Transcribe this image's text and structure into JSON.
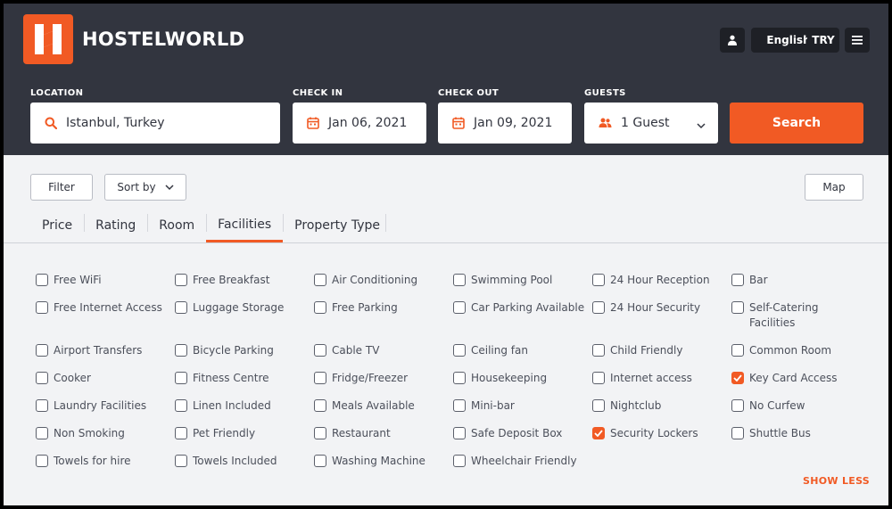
{
  "brand": {
    "name": "HOSTELWORLD",
    "color": "#f15a24"
  },
  "header_buttons": {
    "account_icon": "user-icon",
    "language": "English",
    "currency": "TRY",
    "menu_icon": "hamburger-menu-icon"
  },
  "search": {
    "location_label": "LOCATION",
    "location_value": "Istanbul, Turkey",
    "checkin_label": "CHECK IN",
    "checkin_value": "Jan 06, 2021",
    "checkout_label": "CHECK OUT",
    "checkout_value": "Jan 09, 2021",
    "guests_label": "GUESTS",
    "guests_value": "1 Guest",
    "button": "Search"
  },
  "toolbar": {
    "filter": "Filter",
    "sort": "Sort by",
    "map": "Map"
  },
  "tabs": [
    {
      "label": "Price",
      "active": false
    },
    {
      "label": "Rating",
      "active": false
    },
    {
      "label": "Room",
      "active": false
    },
    {
      "label": "Facilities",
      "active": true
    },
    {
      "label": "Property Type",
      "active": false
    }
  ],
  "facilities": [
    [
      {
        "label": "Free WiFi",
        "checked": false
      },
      {
        "label": "Free Internet Access",
        "checked": false
      },
      {
        "label": "Airport Transfers",
        "checked": false
      },
      {
        "label": "Cooker",
        "checked": false
      },
      {
        "label": "Laundry Facilities",
        "checked": false
      },
      {
        "label": "Non Smoking",
        "checked": false
      },
      {
        "label": "Towels for hire",
        "checked": false
      }
    ],
    [
      {
        "label": "Free Breakfast",
        "checked": false
      },
      {
        "label": "Luggage Storage",
        "checked": false
      },
      {
        "label": "Bicycle Parking",
        "checked": false
      },
      {
        "label": "Fitness Centre",
        "checked": false
      },
      {
        "label": "Linen Included",
        "checked": false
      },
      {
        "label": "Pet Friendly",
        "checked": false
      },
      {
        "label": "Towels Included",
        "checked": false
      }
    ],
    [
      {
        "label": "Air Conditioning",
        "checked": false
      },
      {
        "label": "Free Parking",
        "checked": false
      },
      {
        "label": "Cable TV",
        "checked": false
      },
      {
        "label": "Fridge/Freezer",
        "checked": false
      },
      {
        "label": "Meals Available",
        "checked": false
      },
      {
        "label": "Restaurant",
        "checked": false
      },
      {
        "label": "Washing Machine",
        "checked": false
      }
    ],
    [
      {
        "label": "Swimming Pool",
        "checked": false
      },
      {
        "label": "Car Parking Available",
        "checked": false
      },
      {
        "label": "Ceiling fan",
        "checked": false
      },
      {
        "label": "Housekeeping",
        "checked": false
      },
      {
        "label": "Mini-bar",
        "checked": false
      },
      {
        "label": "Safe Deposit Box",
        "checked": false
      },
      {
        "label": "Wheelchair Friendly",
        "checked": false
      }
    ],
    [
      {
        "label": "24 Hour Reception",
        "checked": false
      },
      {
        "label": "24 Hour Security",
        "checked": false
      },
      {
        "label": "Child Friendly",
        "checked": false
      },
      {
        "label": "Internet access",
        "checked": false
      },
      {
        "label": "Nightclub",
        "checked": false
      },
      {
        "label": "Security Lockers",
        "checked": true
      }
    ],
    [
      {
        "label": "Bar",
        "checked": false
      },
      {
        "label": "Self-Catering Facilities",
        "checked": false
      },
      {
        "label": "Common Room",
        "checked": false
      },
      {
        "label": "Key Card Access",
        "checked": true
      },
      {
        "label": "No Curfew",
        "checked": false
      },
      {
        "label": "Shuttle Bus",
        "checked": false
      }
    ]
  ],
  "show_less": "SHOW LESS"
}
